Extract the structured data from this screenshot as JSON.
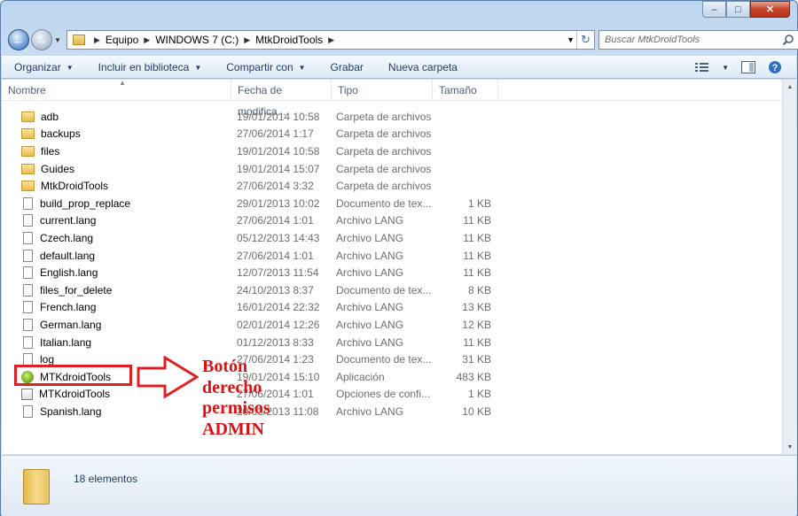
{
  "window": {
    "min_label": "‒",
    "max_label": "□",
    "close_label": "✕"
  },
  "nav": {
    "back_icon": "←",
    "forward_icon": "→",
    "breadcrumbs": [
      "Equipo",
      "WINDOWS 7 (C:)",
      "MtkDroidTools"
    ],
    "search_placeholder": "Buscar MtkDroidTools"
  },
  "toolbar": {
    "organize": "Organizar",
    "include": "Incluir en biblioteca",
    "share": "Compartir con",
    "burn": "Grabar",
    "new_folder": "Nueva carpeta"
  },
  "columns": {
    "name": "Nombre",
    "date": "Fecha de modifica...",
    "type": "Tipo",
    "size": "Tamaño"
  },
  "files": [
    {
      "name": "adb",
      "date": "19/01/2014 10:58",
      "type": "Carpeta de archivos",
      "size": "",
      "icon": "folder"
    },
    {
      "name": "backups",
      "date": "27/06/2014 1:17",
      "type": "Carpeta de archivos",
      "size": "",
      "icon": "folder"
    },
    {
      "name": "files",
      "date": "19/01/2014 10:58",
      "type": "Carpeta de archivos",
      "size": "",
      "icon": "folder"
    },
    {
      "name": "Guides",
      "date": "19/01/2014 15:07",
      "type": "Carpeta de archivos",
      "size": "",
      "icon": "folder"
    },
    {
      "name": "MtkDroidTools",
      "date": "27/06/2014 3:32",
      "type": "Carpeta de archivos",
      "size": "",
      "icon": "folder"
    },
    {
      "name": "build_prop_replace",
      "date": "29/01/2013 10:02",
      "type": "Documento de tex...",
      "size": "1 KB",
      "icon": "file"
    },
    {
      "name": "current.lang",
      "date": "27/06/2014 1:01",
      "type": "Archivo LANG",
      "size": "11 KB",
      "icon": "file"
    },
    {
      "name": "Czech.lang",
      "date": "05/12/2013 14:43",
      "type": "Archivo LANG",
      "size": "11 KB",
      "icon": "file"
    },
    {
      "name": "default.lang",
      "date": "27/06/2014 1:01",
      "type": "Archivo LANG",
      "size": "11 KB",
      "icon": "file"
    },
    {
      "name": "English.lang",
      "date": "12/07/2013 11:54",
      "type": "Archivo LANG",
      "size": "11 KB",
      "icon": "file"
    },
    {
      "name": "files_for_delete",
      "date": "24/10/2013 8:37",
      "type": "Documento de tex...",
      "size": "8 KB",
      "icon": "file"
    },
    {
      "name": "French.lang",
      "date": "16/01/2014 22:32",
      "type": "Archivo LANG",
      "size": "13 KB",
      "icon": "file"
    },
    {
      "name": "German.lang",
      "date": "02/01/2014 12:26",
      "type": "Archivo LANG",
      "size": "12 KB",
      "icon": "file"
    },
    {
      "name": "Italian.lang",
      "date": "01/12/2013 8:33",
      "type": "Archivo LANG",
      "size": "11 KB",
      "icon": "file"
    },
    {
      "name": "log",
      "date": "27/06/2014 1:23",
      "type": "Documento de tex...",
      "size": "31 KB",
      "icon": "file"
    },
    {
      "name": "MTKdroidTools",
      "date": "19/01/2014 15:10",
      "type": "Aplicación",
      "size": "483 KB",
      "icon": "app"
    },
    {
      "name": "MTKdroidTools",
      "date": "27/06/2014 1:01",
      "type": "Opciones de confi...",
      "size": "1 KB",
      "icon": "config"
    },
    {
      "name": "Spanish.lang",
      "date": "20/03/2013 11:08",
      "type": "Archivo LANG",
      "size": "10 KB",
      "icon": "file"
    }
  ],
  "annotation": [
    "Botón",
    "derecho",
    "permisos",
    "ADMIN"
  ],
  "status": {
    "count": "18 elementos"
  },
  "colors": {
    "annotation": "#dd1111",
    "highlight": "#e02020",
    "window_frame": "#bcd4ee"
  }
}
